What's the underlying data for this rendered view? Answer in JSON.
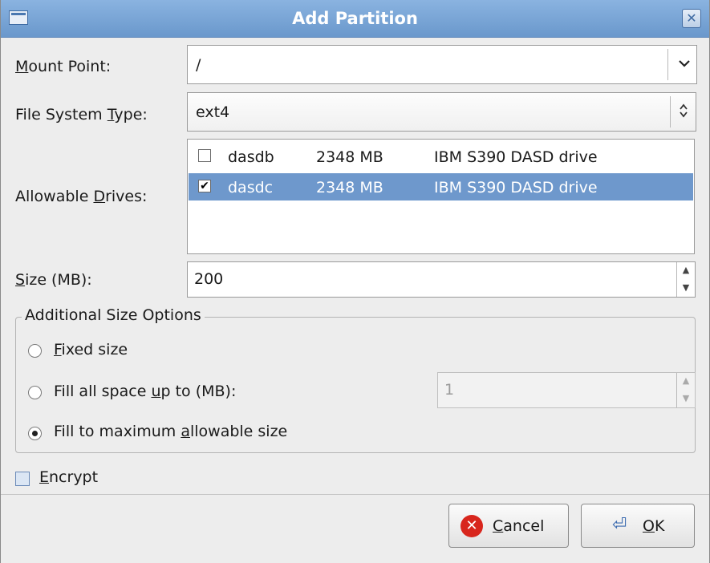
{
  "window": {
    "title": "Add Partition"
  },
  "mount_point": {
    "label": "Mount Point:",
    "value": "/"
  },
  "fs_type": {
    "label": "File System Type:",
    "value": "ext4"
  },
  "drives": {
    "label": "Allowable Drives:",
    "rows": [
      {
        "checked": false,
        "name": "dasdb",
        "size": "2348 MB",
        "model": "IBM S390 DASD drive",
        "selected": false
      },
      {
        "checked": true,
        "name": "dasdc",
        "size": "2348 MB",
        "model": "IBM S390 DASD drive",
        "selected": true
      }
    ]
  },
  "size": {
    "label": "Size (MB):",
    "value": "200"
  },
  "size_options": {
    "title": "Additional Size Options",
    "fixed": "Fixed size",
    "fill_up_to": "Fill all space up to (MB):",
    "fill_up_to_value": "1",
    "fill_max": "Fill to maximum allowable size",
    "selected": "fill_max"
  },
  "encrypt": {
    "label": "Encrypt",
    "checked": false
  },
  "buttons": {
    "cancel": "Cancel",
    "ok": "OK"
  },
  "colors": {
    "titlebar": "#7aa6d8",
    "selection": "#6e98cc",
    "cancel_icon": "#d8261d"
  }
}
